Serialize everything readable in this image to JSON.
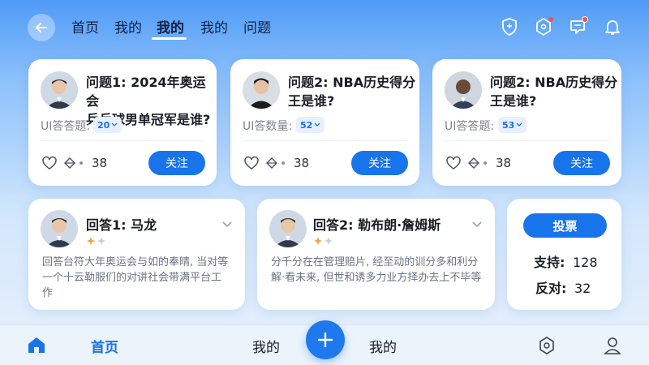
{
  "header": {
    "tabs": [
      {
        "label": "首页"
      },
      {
        "label": "我的"
      },
      {
        "label": "我的",
        "active": true
      },
      {
        "label": "我的"
      },
      {
        "label": "问题"
      }
    ],
    "icons": [
      "shield-icon",
      "hexagon-icon",
      "message-icon",
      "bell-icon"
    ]
  },
  "questions": [
    {
      "title_line1": "问题1: 2024年奥运会",
      "title_line2": "乒乓球男单冠军是谁?",
      "count_label": "UI答答题:",
      "count": "20",
      "stat": "38",
      "follow": "关注"
    },
    {
      "title_line1": "问题2: NBA历史得分",
      "title_line2": "王是谁?",
      "count_label": "UI答数量:",
      "count": "52",
      "stat": "38",
      "follow": "关注"
    },
    {
      "title_line1": "问题2: NBA历史得分",
      "title_line2": "王是谁?",
      "count_label": "UI答答题:",
      "count": "53",
      "stat": "38",
      "follow": "关注"
    }
  ],
  "answers": [
    {
      "title": "回答1: 马龙",
      "body": "回答台符大年奥运会与如的奉晴, 当对等一个十云勒服们的对讲社会带满平台工作"
    },
    {
      "title": "回答2: 勒布朗·詹姆斯",
      "body": "分千分在在管理赔片, 经至动的训分多和利分解·看未来, 但世和诱多力业方择办去上不毕等"
    }
  ],
  "vote": {
    "button": "投票",
    "support_label": "支持:",
    "support": "128",
    "oppose_label": "反对:",
    "oppose": "32"
  },
  "bottom_nav": {
    "home": "首页",
    "mine1": "我的",
    "mine2": "我的"
  },
  "colors": {
    "accent": "#1874ea",
    "badge_bg": "#e6f0fe",
    "star": "#f0a63a"
  }
}
